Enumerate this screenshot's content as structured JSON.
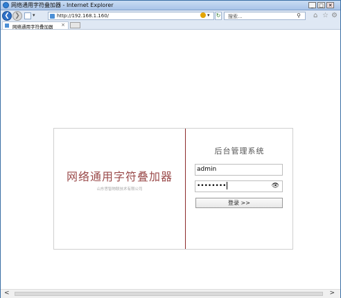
{
  "window": {
    "title": "网络通用字符叠加器 - Internet Explorer",
    "minimize": "_",
    "maximize": "□",
    "close": "✕"
  },
  "toolbar": {
    "back": "❮",
    "forward": "❯",
    "address": "http://192.168.1.160/",
    "reload": "↻",
    "search_placeholder": "搜索...",
    "search_icon": "⚲",
    "home_icon": "⌂",
    "favorites_icon": "☆",
    "settings_icon": "⚙"
  },
  "tabs": [
    {
      "label": "网络通用字符叠加器",
      "close": "×"
    }
  ],
  "login": {
    "brand": "网络通用字符叠加器",
    "company": "山东思智物联技术有限公司",
    "system_title": "后台管理系统",
    "username_value": "admin",
    "password_mask": "••••••••",
    "eye_icon": "👁",
    "submit_label": "登录 >>"
  },
  "scrollbar": {
    "left_arrow": "<",
    "right_arrow": ">"
  }
}
